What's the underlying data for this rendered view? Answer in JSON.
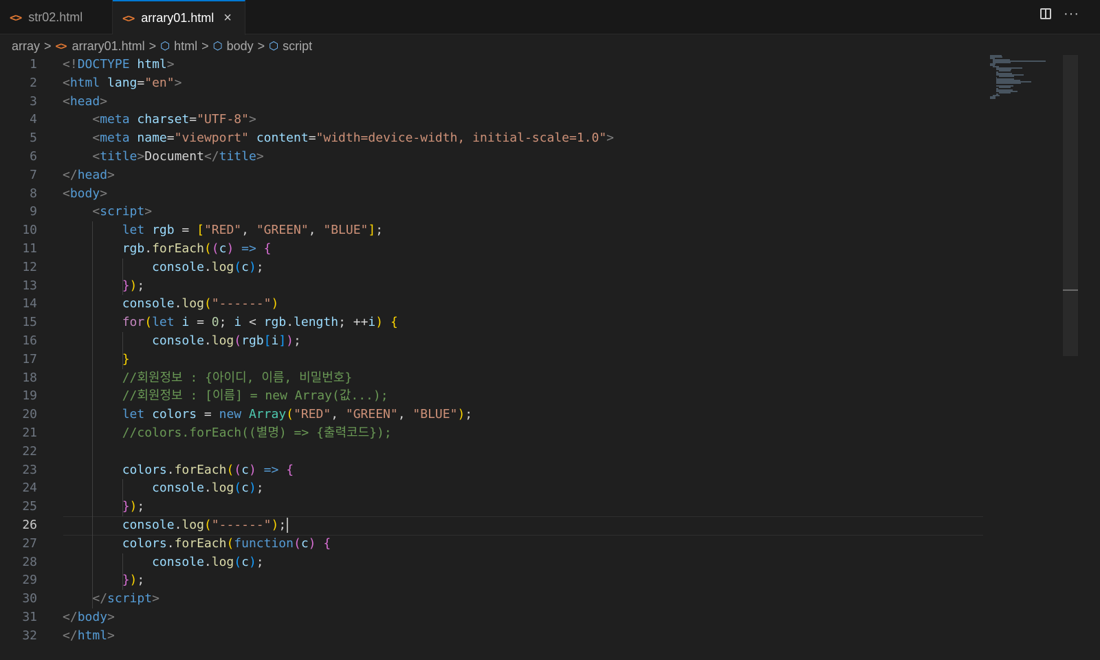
{
  "tabs": [
    {
      "label": "str02.html",
      "icon": "html-file-icon",
      "active": false
    },
    {
      "label": "arrary01.html",
      "icon": "html-file-icon",
      "active": true,
      "close": "×"
    }
  ],
  "top_actions": {
    "more": "···"
  },
  "breadcrumb": {
    "folder": "array",
    "file": "arrary01.html",
    "items": [
      "html",
      "body",
      "script"
    ],
    "separator": ">"
  },
  "editor": {
    "current_line": 26,
    "lines": [
      {
        "n": "1"
      },
      {
        "n": "2"
      },
      {
        "n": "3"
      },
      {
        "n": "4"
      },
      {
        "n": "5"
      },
      {
        "n": "6"
      },
      {
        "n": "7"
      },
      {
        "n": "8"
      },
      {
        "n": "9"
      },
      {
        "n": "10"
      },
      {
        "n": "11"
      },
      {
        "n": "12"
      },
      {
        "n": "13"
      },
      {
        "n": "14"
      },
      {
        "n": "15"
      },
      {
        "n": "16"
      },
      {
        "n": "17"
      },
      {
        "n": "18"
      },
      {
        "n": "19"
      },
      {
        "n": "20"
      },
      {
        "n": "21"
      },
      {
        "n": "22"
      },
      {
        "n": "23"
      },
      {
        "n": "24"
      },
      {
        "n": "25"
      },
      {
        "n": "26"
      },
      {
        "n": "27"
      },
      {
        "n": "28"
      },
      {
        "n": "29"
      },
      {
        "n": "30"
      },
      {
        "n": "31"
      },
      {
        "n": "32"
      }
    ],
    "code": [
      [
        [
          "t-punc",
          "<!"
        ],
        [
          "t-tag",
          "DOCTYPE"
        ],
        [
          "t-text",
          " "
        ],
        [
          "t-attr",
          "html"
        ],
        [
          "t-punc",
          ">"
        ]
      ],
      [
        [
          "t-punc",
          "<"
        ],
        [
          "t-tag",
          "html"
        ],
        [
          "t-text",
          " "
        ],
        [
          "t-attr",
          "lang"
        ],
        [
          "t-op",
          "="
        ],
        [
          "t-str",
          "\"en\""
        ],
        [
          "t-punc",
          ">"
        ]
      ],
      [
        [
          "t-punc",
          "<"
        ],
        [
          "t-tag",
          "head"
        ],
        [
          "t-punc",
          ">"
        ]
      ],
      [
        [
          "t-text",
          "    "
        ],
        [
          "t-punc",
          "<"
        ],
        [
          "t-tag",
          "meta"
        ],
        [
          "t-text",
          " "
        ],
        [
          "t-attr",
          "charset"
        ],
        [
          "t-op",
          "="
        ],
        [
          "t-str",
          "\"UTF-8\""
        ],
        [
          "t-punc",
          ">"
        ]
      ],
      [
        [
          "t-text",
          "    "
        ],
        [
          "t-punc",
          "<"
        ],
        [
          "t-tag",
          "meta"
        ],
        [
          "t-text",
          " "
        ],
        [
          "t-attr",
          "name"
        ],
        [
          "t-op",
          "="
        ],
        [
          "t-str",
          "\"viewport\""
        ],
        [
          "t-text",
          " "
        ],
        [
          "t-attr",
          "content"
        ],
        [
          "t-op",
          "="
        ],
        [
          "t-str",
          "\"width=device-width, initial-scale=1.0\""
        ],
        [
          "t-punc",
          ">"
        ]
      ],
      [
        [
          "t-text",
          "    "
        ],
        [
          "t-punc",
          "<"
        ],
        [
          "t-tag",
          "title"
        ],
        [
          "t-punc",
          ">"
        ],
        [
          "t-text",
          "Document"
        ],
        [
          "t-punc",
          "</"
        ],
        [
          "t-tag",
          "title"
        ],
        [
          "t-punc",
          ">"
        ]
      ],
      [
        [
          "t-punc",
          "</"
        ],
        [
          "t-tag",
          "head"
        ],
        [
          "t-punc",
          ">"
        ]
      ],
      [
        [
          "t-punc",
          "<"
        ],
        [
          "t-tag",
          "body"
        ],
        [
          "t-punc",
          ">"
        ]
      ],
      [
        [
          "t-text",
          "    "
        ],
        [
          "t-punc",
          "<"
        ],
        [
          "t-tag",
          "script"
        ],
        [
          "t-punc",
          ">"
        ]
      ],
      [
        [
          "t-text",
          "        "
        ],
        [
          "t-kw",
          "let"
        ],
        [
          "t-text",
          " "
        ],
        [
          "t-var",
          "rgb"
        ],
        [
          "t-op",
          " = "
        ],
        [
          "b1",
          "["
        ],
        [
          "t-str",
          "\"RED\""
        ],
        [
          "t-op",
          ", "
        ],
        [
          "t-str",
          "\"GREEN\""
        ],
        [
          "t-op",
          ", "
        ],
        [
          "t-str",
          "\"BLUE\""
        ],
        [
          "b1",
          "]"
        ],
        [
          "t-op",
          ";"
        ]
      ],
      [
        [
          "t-text",
          "        "
        ],
        [
          "t-var",
          "rgb"
        ],
        [
          "t-op",
          "."
        ],
        [
          "t-fn",
          "forEach"
        ],
        [
          "b1",
          "("
        ],
        [
          "b2",
          "("
        ],
        [
          "t-var",
          "c"
        ],
        [
          "b2",
          ")"
        ],
        [
          "t-op",
          " "
        ],
        [
          "t-kw",
          "=>"
        ],
        [
          "t-op",
          " "
        ],
        [
          "b2",
          "{"
        ]
      ],
      [
        [
          "t-text",
          "            "
        ],
        [
          "t-var",
          "console"
        ],
        [
          "t-op",
          "."
        ],
        [
          "t-fn",
          "log"
        ],
        [
          "b3",
          "("
        ],
        [
          "t-var",
          "c"
        ],
        [
          "b3",
          ")"
        ],
        [
          "t-op",
          ";"
        ]
      ],
      [
        [
          "t-text",
          "        "
        ],
        [
          "b2",
          "}"
        ],
        [
          "b1",
          ")"
        ],
        [
          "t-op",
          ";"
        ]
      ],
      [
        [
          "t-text",
          "        "
        ],
        [
          "t-var",
          "console"
        ],
        [
          "t-op",
          "."
        ],
        [
          "t-fn",
          "log"
        ],
        [
          "b1",
          "("
        ],
        [
          "t-str",
          "\"------\""
        ],
        [
          "b1",
          ")"
        ]
      ],
      [
        [
          "t-text",
          "        "
        ],
        [
          "t-ctl",
          "for"
        ],
        [
          "b1",
          "("
        ],
        [
          "t-kw",
          "let"
        ],
        [
          "t-text",
          " "
        ],
        [
          "t-var",
          "i"
        ],
        [
          "t-op",
          " = "
        ],
        [
          "t-num",
          "0"
        ],
        [
          "t-op",
          "; "
        ],
        [
          "t-var",
          "i"
        ],
        [
          "t-op",
          " < "
        ],
        [
          "t-var",
          "rgb"
        ],
        [
          "t-op",
          "."
        ],
        [
          "t-var",
          "length"
        ],
        [
          "t-op",
          "; ++"
        ],
        [
          "t-var",
          "i"
        ],
        [
          "b1",
          ")"
        ],
        [
          "t-op",
          " "
        ],
        [
          "b1",
          "{"
        ]
      ],
      [
        [
          "t-text",
          "            "
        ],
        [
          "t-var",
          "console"
        ],
        [
          "t-op",
          "."
        ],
        [
          "t-fn",
          "log"
        ],
        [
          "b2",
          "("
        ],
        [
          "t-var",
          "rgb"
        ],
        [
          "b3",
          "["
        ],
        [
          "t-var",
          "i"
        ],
        [
          "b3",
          "]"
        ],
        [
          "b2",
          ")"
        ],
        [
          "t-op",
          ";"
        ]
      ],
      [
        [
          "t-text",
          "        "
        ],
        [
          "b1",
          "}"
        ]
      ],
      [
        [
          "t-text",
          "        "
        ],
        [
          "t-com",
          "//회원정보 : {아이디, 이름, 비밀번호}"
        ]
      ],
      [
        [
          "t-text",
          "        "
        ],
        [
          "t-com",
          "//회원정보 : [이름] = new Array(값...);"
        ]
      ],
      [
        [
          "t-text",
          "        "
        ],
        [
          "t-kw",
          "let"
        ],
        [
          "t-text",
          " "
        ],
        [
          "t-var",
          "colors"
        ],
        [
          "t-op",
          " = "
        ],
        [
          "t-kw",
          "new"
        ],
        [
          "t-text",
          " "
        ],
        [
          "t-cls",
          "Array"
        ],
        [
          "b1",
          "("
        ],
        [
          "t-str",
          "\"RED\""
        ],
        [
          "t-op",
          ", "
        ],
        [
          "t-str",
          "\"GREEN\""
        ],
        [
          "t-op",
          ", "
        ],
        [
          "t-str",
          "\"BLUE\""
        ],
        [
          "b1",
          ")"
        ],
        [
          "t-op",
          ";"
        ]
      ],
      [
        [
          "t-text",
          "        "
        ],
        [
          "t-com",
          "//colors.forEach((별명) => {출력코드});"
        ]
      ],
      [],
      [
        [
          "t-text",
          "        "
        ],
        [
          "t-var",
          "colors"
        ],
        [
          "t-op",
          "."
        ],
        [
          "t-fn",
          "forEach"
        ],
        [
          "b1",
          "("
        ],
        [
          "b2",
          "("
        ],
        [
          "t-var",
          "c"
        ],
        [
          "b2",
          ")"
        ],
        [
          "t-op",
          " "
        ],
        [
          "t-kw",
          "=>"
        ],
        [
          "t-op",
          " "
        ],
        [
          "b2",
          "{"
        ]
      ],
      [
        [
          "t-text",
          "            "
        ],
        [
          "t-var",
          "console"
        ],
        [
          "t-op",
          "."
        ],
        [
          "t-fn",
          "log"
        ],
        [
          "b3",
          "("
        ],
        [
          "t-var",
          "c"
        ],
        [
          "b3",
          ")"
        ],
        [
          "t-op",
          ";"
        ]
      ],
      [
        [
          "t-text",
          "        "
        ],
        [
          "b2",
          "}"
        ],
        [
          "b1",
          ")"
        ],
        [
          "t-op",
          ";"
        ]
      ],
      [
        [
          "t-text",
          "        "
        ],
        [
          "t-var",
          "console"
        ],
        [
          "t-op",
          "."
        ],
        [
          "t-fn",
          "log"
        ],
        [
          "b1",
          "("
        ],
        [
          "t-str",
          "\"------\""
        ],
        [
          "b1",
          ")"
        ],
        [
          "t-op",
          ";"
        ]
      ],
      [
        [
          "t-text",
          "        "
        ],
        [
          "t-var",
          "colors"
        ],
        [
          "t-op",
          "."
        ],
        [
          "t-fn",
          "forEach"
        ],
        [
          "b1",
          "("
        ],
        [
          "t-kw",
          "function"
        ],
        [
          "b2",
          "("
        ],
        [
          "t-var",
          "c"
        ],
        [
          "b2",
          ")"
        ],
        [
          "t-op",
          " "
        ],
        [
          "b2",
          "{"
        ]
      ],
      [
        [
          "t-text",
          "            "
        ],
        [
          "t-var",
          "console"
        ],
        [
          "t-op",
          "."
        ],
        [
          "t-fn",
          "log"
        ],
        [
          "b3",
          "("
        ],
        [
          "t-var",
          "c"
        ],
        [
          "b3",
          ")"
        ],
        [
          "t-op",
          ";"
        ]
      ],
      [
        [
          "t-text",
          "        "
        ],
        [
          "b2",
          "}"
        ],
        [
          "b1",
          ")"
        ],
        [
          "t-op",
          ";"
        ]
      ],
      [
        [
          "t-text",
          "    "
        ],
        [
          "t-punc",
          "</"
        ],
        [
          "t-tag",
          "script"
        ],
        [
          "t-punc",
          ">"
        ]
      ],
      [
        [
          "t-punc",
          "</"
        ],
        [
          "t-tag",
          "body"
        ],
        [
          "t-punc",
          ">"
        ]
      ],
      [
        [
          "t-punc",
          "</"
        ],
        [
          "t-tag",
          "html"
        ],
        [
          "t-punc",
          ">"
        ]
      ]
    ]
  }
}
